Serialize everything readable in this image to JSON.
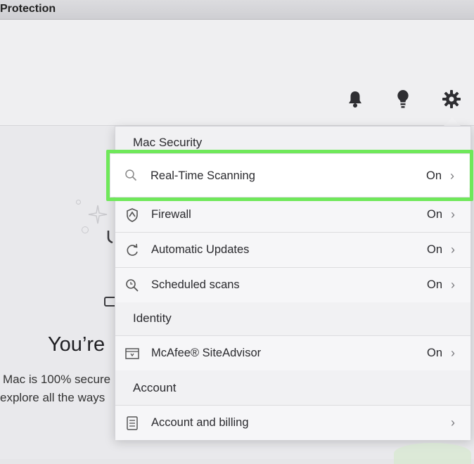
{
  "window": {
    "title": "Protection"
  },
  "toolbar": {
    "icons": [
      "bell-icon",
      "lightbulb-icon",
      "gear-icon"
    ]
  },
  "hero": {
    "title": "You’re",
    "line1": "Mac is 100% secure",
    "line2": "explore all the ways"
  },
  "menu": {
    "sections": [
      {
        "heading": "Mac Security",
        "items": [
          {
            "label": "Real-Time Scanning",
            "status": "On",
            "icon": "search-icon",
            "highlighted": true
          },
          {
            "label": "Firewall",
            "status": "On",
            "icon": "shield-icon"
          },
          {
            "label": "Automatic Updates",
            "status": "On",
            "icon": "refresh-icon"
          },
          {
            "label": "Scheduled scans",
            "status": "On",
            "icon": "scheduled-scan-icon"
          }
        ]
      },
      {
        "heading": "Identity",
        "items": [
          {
            "label": "McAfee® SiteAdvisor",
            "status": "On",
            "icon": "browser-icon"
          }
        ]
      },
      {
        "heading": "Account",
        "items": [
          {
            "label": "Account and billing",
            "status": "",
            "icon": "billing-icon"
          }
        ]
      }
    ]
  },
  "colors": {
    "highlight": "#6fe85a",
    "menu_background": "#f1f1f3"
  }
}
